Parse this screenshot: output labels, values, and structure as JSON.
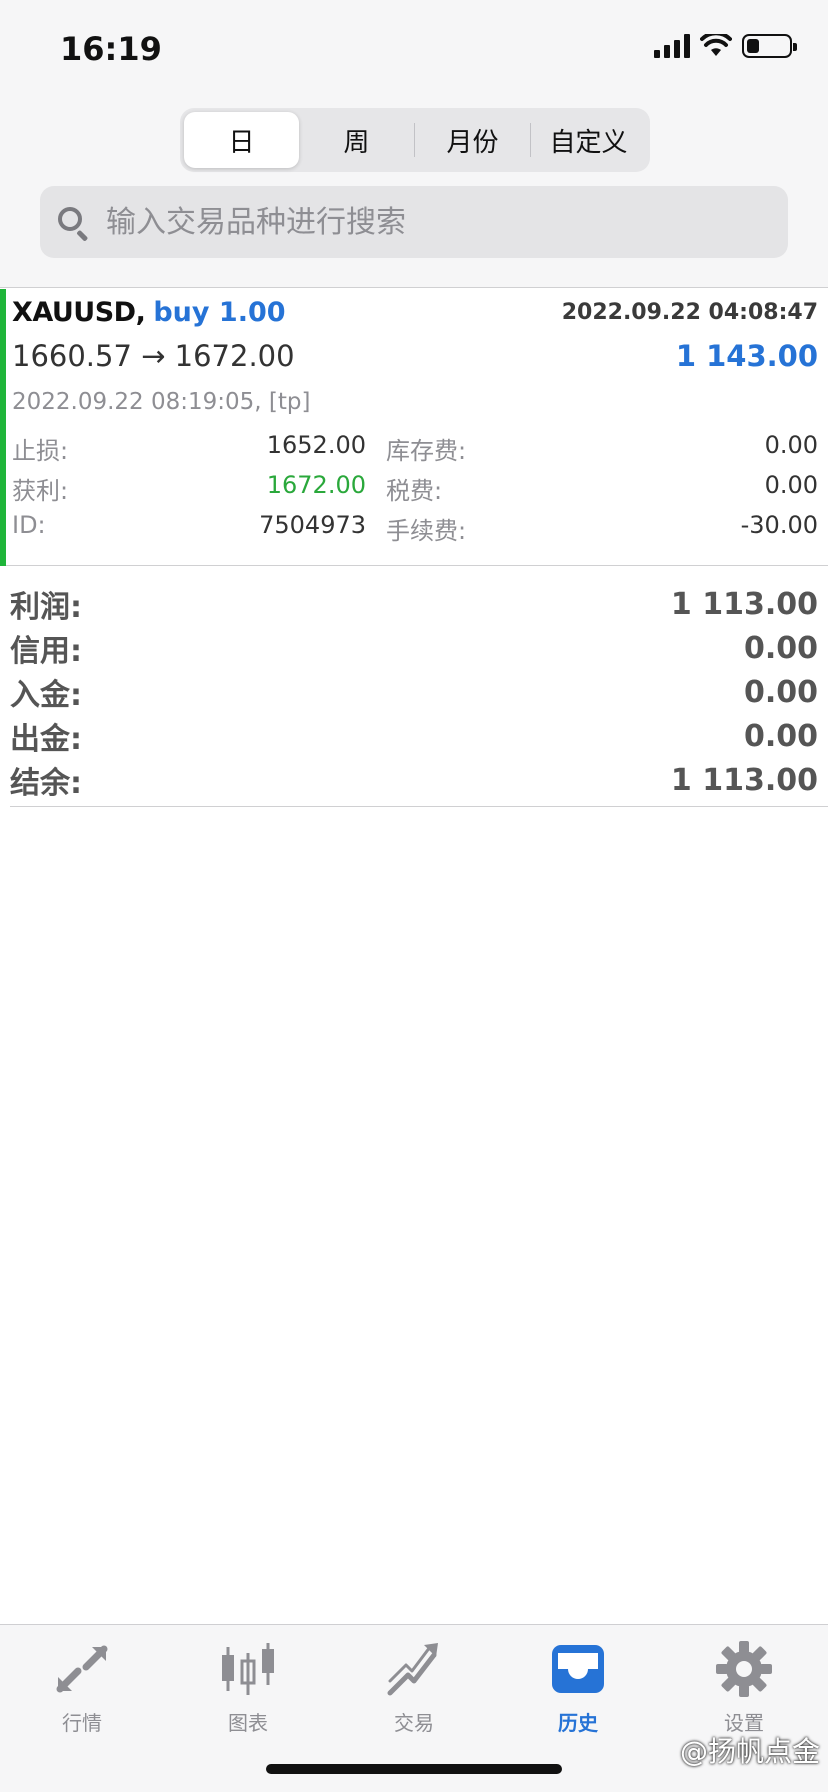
{
  "status_bar": {
    "time": "16:19"
  },
  "segment": {
    "items": [
      {
        "label": "日"
      },
      {
        "label": "周"
      },
      {
        "label": "月份"
      },
      {
        "label": "自定义"
      }
    ]
  },
  "search": {
    "placeholder": "输入交易品种进行搜索"
  },
  "trade": {
    "symbol": "XAUUSD,",
    "side": "buy 1.00",
    "open_time": "2022.09.22 04:08:47",
    "prices": "1660.57 → 1672.00",
    "profit": "1 143.00",
    "close_info": "2022.09.22 08:19:05, [tp]",
    "details": [
      {
        "label": "止损:",
        "value": "1652.00",
        "label2": "库存费:",
        "value2": "0.00"
      },
      {
        "label": "获利:",
        "value": "1672.00",
        "label2": "税费:",
        "value2": "0.00"
      },
      {
        "label": "ID:",
        "value": "7504973",
        "label2": "手续费:",
        "value2": "-30.00"
      }
    ]
  },
  "summary": [
    {
      "label": "利润:",
      "value": "1 113.00"
    },
    {
      "label": "信用:",
      "value": "0.00"
    },
    {
      "label": "入金:",
      "value": "0.00"
    },
    {
      "label": "出金:",
      "value": "0.00"
    },
    {
      "label": "结余:",
      "value": "1 113.00"
    }
  ],
  "tabbar": {
    "items": [
      {
        "label": "行情",
        "icon": "quotes-arrows-icon"
      },
      {
        "label": "图表",
        "icon": "candlestick-chart-icon"
      },
      {
        "label": "交易",
        "icon": "trade-trend-icon"
      },
      {
        "label": "历史",
        "icon": "history-inbox-icon"
      },
      {
        "label": "设置",
        "icon": "gear-icon"
      }
    ]
  },
  "watermark": "@扬帆点金",
  "colors": {
    "accent": "#2673d6",
    "position_bar": "#1fb53a",
    "take_profit": "#2aa83b",
    "tab_inactive": "#8e8e93"
  }
}
